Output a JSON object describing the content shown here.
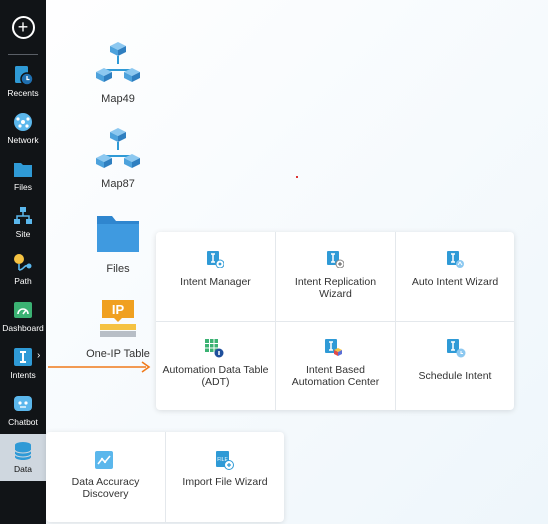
{
  "sidebar": {
    "items": [
      {
        "label": "Recents",
        "icon": "recents-icon"
      },
      {
        "label": "Network",
        "icon": "network-icon"
      },
      {
        "label": "Files",
        "icon": "folder-icon"
      },
      {
        "label": "Site",
        "icon": "site-icon"
      },
      {
        "label": "Path",
        "icon": "path-icon"
      },
      {
        "label": "Dashboard",
        "icon": "dashboard-icon"
      },
      {
        "label": "Intents",
        "icon": "intents-icon"
      },
      {
        "label": "Chatbot",
        "icon": "chatbot-icon"
      },
      {
        "label": "Data",
        "icon": "data-icon"
      }
    ]
  },
  "desktop": {
    "items": [
      {
        "label": "Map49"
      },
      {
        "label": "Map87"
      },
      {
        "label": "Files"
      },
      {
        "label": "One-IP Table"
      }
    ]
  },
  "intents_menu": {
    "items": [
      {
        "label": "Intent Manager"
      },
      {
        "label": "Intent Replication Wizard"
      },
      {
        "label": "Auto Intent Wizard"
      },
      {
        "label": "Automation Data Table (ADT)"
      },
      {
        "label": "Intent Based Automation Center"
      },
      {
        "label": "Schedule Intent"
      }
    ]
  },
  "data_menu": {
    "items": [
      {
        "label": "Data Accuracy Discovery"
      },
      {
        "label": "Import File Wizard"
      }
    ]
  },
  "colors": {
    "accent": "#2f9ad6",
    "orange": "#f07a1a",
    "sidebar_bg": "#111417"
  }
}
